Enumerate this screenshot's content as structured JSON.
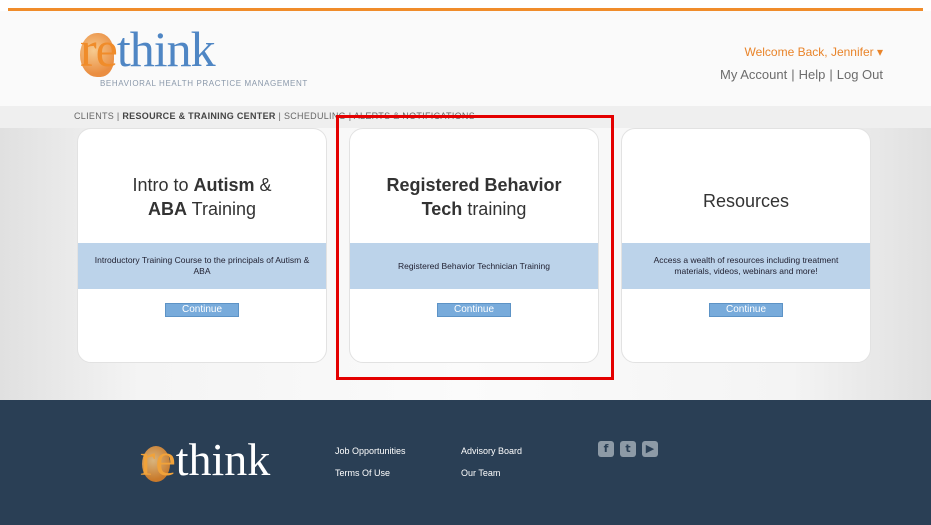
{
  "brand": {
    "logo_re": "re",
    "logo_rest": "think",
    "tagline": "BEHAVIORAL HEALTH PRACTICE MANAGEMENT",
    "accent_color": "#f08c2a",
    "primary_color": "#4f86c4"
  },
  "header": {
    "welcome": "Welcome Back, Jennifer ▾",
    "links": [
      "My Account",
      "Help",
      "Log Out"
    ]
  },
  "nav": {
    "items": [
      "CLIENTS",
      "RESOURCE & TRAINING CENTER",
      "SCHEDULING",
      "ALERTS & NOTIFICATIONS"
    ]
  },
  "cards": [
    {
      "title_a": "Intro to ",
      "title_b": "Autism",
      "title_c": " &",
      "title_d": "ABA",
      "title_e": " Training",
      "description": "Introductory Training Course to the principals of Autism & ABA",
      "button": "Continue"
    },
    {
      "title_a": "Registered Behavior",
      "title_b": "Tech",
      "title_c": " training",
      "description": "Registered Behavior Technician Training",
      "button": "Continue"
    },
    {
      "title_a": "Resources",
      "description": "Access a wealth of resources including treatment materials, videos, webinars and more!",
      "button": "Continue"
    }
  ],
  "footer": {
    "logo_re": "re",
    "logo_rest": "think",
    "col1": [
      "Job Opportunities",
      "Terms Of Use"
    ],
    "col2": [
      "Advisory Board",
      "Our Team"
    ],
    "social": [
      {
        "icon": "facebook-icon",
        "glyph": "f"
      },
      {
        "icon": "twitter-icon",
        "glyph": "t"
      },
      {
        "icon": "youtube-icon",
        "glyph": "▶"
      }
    ],
    "bg_color": "#2a3f55"
  },
  "highlight_color": "#e40000"
}
